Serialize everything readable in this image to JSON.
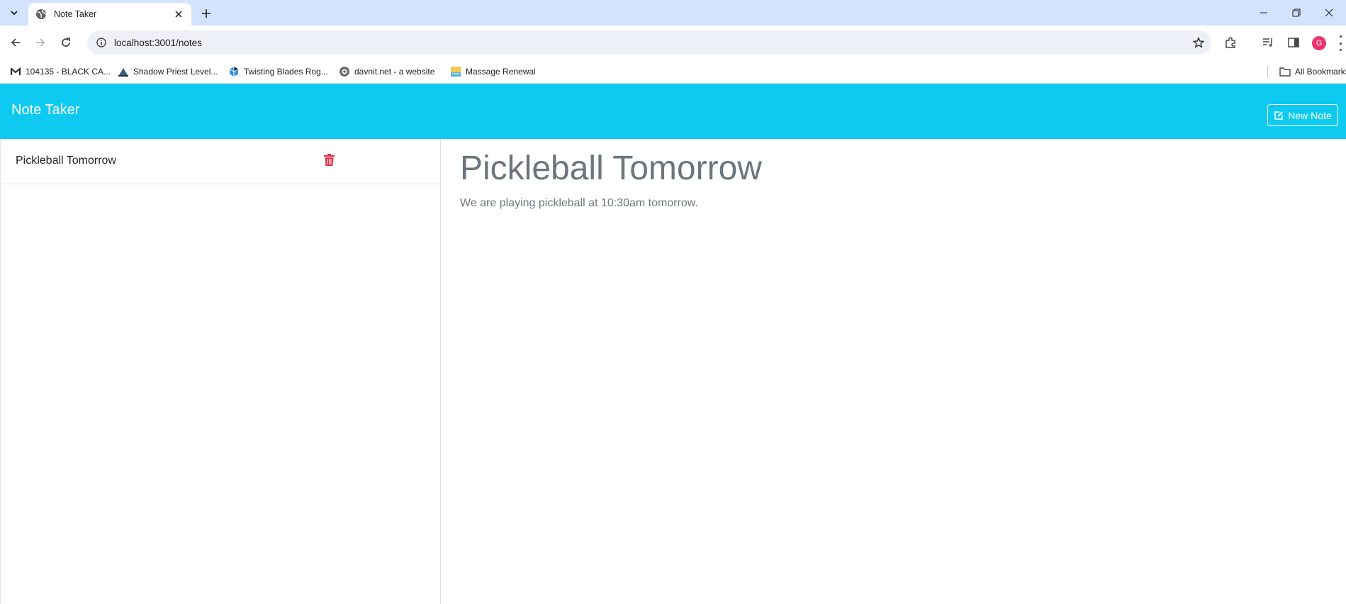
{
  "browser": {
    "tab_title": "Note Taker",
    "url": "localhost:3001/notes",
    "avatar_letter": "G",
    "bookmarks": [
      {
        "label": "104135 - BLACK CA...",
        "icon": "gmail-icon"
      },
      {
        "label": "Shadow Priest Level...",
        "icon": "shadow-priest-icon"
      },
      {
        "label": "Twisting Blades Rog...",
        "icon": "twisting-blades-icon"
      },
      {
        "label": "davnit.net - a website",
        "icon": "davnit-icon"
      },
      {
        "label": "Massage Renewal",
        "icon": "massage-renewal-icon"
      }
    ],
    "all_bookmarks_label": "All Bookmarks"
  },
  "app": {
    "brand": "Note Taker",
    "new_note_label": "New Note",
    "colors": {
      "navbar": "#0fcaf0",
      "delete": "#dc3545",
      "muted_text": "#6c757d"
    }
  },
  "notes": [
    {
      "title": "Pickleball Tomorrow"
    }
  ],
  "active_note": {
    "title": "Pickleball Tomorrow",
    "text": "We are playing pickleball at 10:30am tomorrow."
  }
}
